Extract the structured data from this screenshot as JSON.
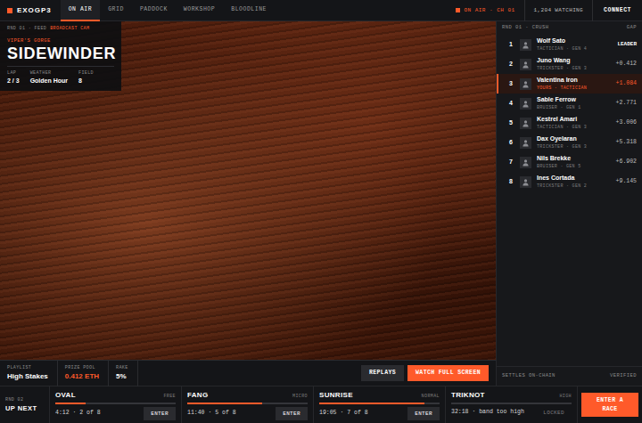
{
  "app": {
    "logo": "EXOGP3"
  },
  "tabs": [
    {
      "label": "ON AIR",
      "selected": true
    },
    {
      "label": "GRID",
      "selected": false
    },
    {
      "label": "PADDOCK",
      "selected": false
    },
    {
      "label": "WORKSHOP",
      "selected": false
    },
    {
      "label": "BLOODLINE",
      "selected": false
    }
  ],
  "status": {
    "live": "ON AIR · CH 01",
    "watching": "1,204 WATCHING",
    "connect": "CONNECT"
  },
  "broadcast": {
    "feed_label": "RND 01 · FEED",
    "feed": "BROADCAST CAM",
    "track": "VIPER'S GORGE",
    "title": "SIDEWINDER",
    "stats": [
      {
        "label": "LAP",
        "value": "2 / 3"
      },
      {
        "label": "WEATHER",
        "value": "Golden Hour"
      },
      {
        "label": "FIELD",
        "value": "8"
      }
    ]
  },
  "info_strip": {
    "stats": [
      {
        "label": "PLAYLIST",
        "value": "High Stakes",
        "accent": false
      },
      {
        "label": "PRIZE POOL",
        "value": "0.412 ETH",
        "accent": true
      },
      {
        "label": "RAKE",
        "value": "5%",
        "accent": false
      }
    ],
    "buttons": [
      {
        "label": "REPLAYS",
        "primary": false
      },
      {
        "label": "WATCH FULL SCREEN",
        "primary": true
      }
    ]
  },
  "standings": {
    "heading": "RND 01 · CRUSH",
    "gap_heading": "GAP",
    "rows": [
      {
        "pos": "1",
        "name": "Wolf Sato",
        "detail": "TACTICIAN · GEN 4",
        "gap": "LEADER",
        "highlighted": false
      },
      {
        "pos": "2",
        "name": "Juno Wang",
        "detail": "TRICKSTER · GEN 3",
        "gap": "+0.412",
        "highlighted": false
      },
      {
        "pos": "3",
        "name": "Valentina Iron",
        "detail": "YOURS · TACTICIAN",
        "gap": "+1.084",
        "highlighted": true
      },
      {
        "pos": "4",
        "name": "Sable Ferrow",
        "detail": "BRUISER · GEN 1",
        "gap": "+2.771",
        "highlighted": false
      },
      {
        "pos": "5",
        "name": "Kestrel Amari",
        "detail": "TACTICIAN · GEN 3",
        "gap": "+3.006",
        "highlighted": false
      },
      {
        "pos": "6",
        "name": "Dax Oyelaran",
        "detail": "TRICKSTER · GEN 3",
        "gap": "+5.318",
        "highlighted": false
      },
      {
        "pos": "7",
        "name": "Nils Brekke",
        "detail": "BRUISER · GEN 5",
        "gap": "+6.902",
        "highlighted": false
      },
      {
        "pos": "8",
        "name": "Ines Cortada",
        "detail": "TRICKSTER · GEN 2",
        "gap": "+9.145",
        "highlighted": false
      }
    ],
    "footer": "SETTLES ON-CHAIN",
    "footer_status": "VERIFIED"
  },
  "up_next": {
    "round": "RND 02",
    "label": "UP NEXT",
    "races": [
      {
        "name": "OVAL",
        "tier": "FREE",
        "info": "4:12 · 2 of 8",
        "action": "ENTER",
        "level": 0.25,
        "locked": false
      },
      {
        "name": "FANG",
        "tier": "MICRO",
        "info": "11:40 · 5 of 8",
        "action": "ENTER",
        "level": 0.625,
        "locked": false
      },
      {
        "name": "SUNRISE",
        "tier": "NORMAL",
        "info": "19:05 · 7 of 8",
        "action": "ENTER",
        "level": 0.875,
        "locked": false
      },
      {
        "name": "TRIKNOT",
        "tier": "HIGH",
        "info": "32:18 · band too high",
        "action": "LOCKED",
        "level": 0,
        "locked": true
      }
    ],
    "cta": "ENTER A RACE"
  }
}
